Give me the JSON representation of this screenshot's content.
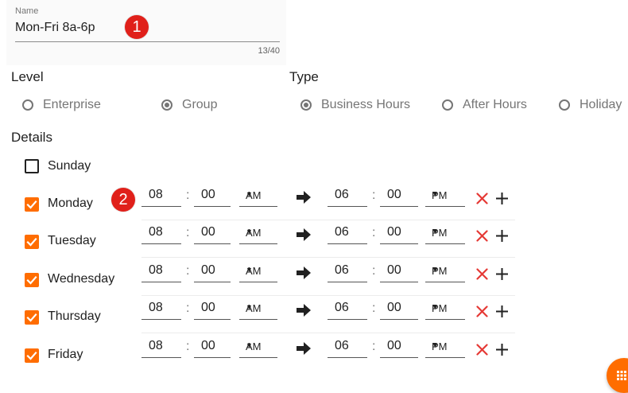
{
  "name_field": {
    "label": "Name",
    "value": "Mon-Fri 8a-6p",
    "counter": "13/40"
  },
  "markers": [
    "1",
    "2"
  ],
  "level": {
    "title": "Level",
    "options": [
      {
        "label": "Enterprise",
        "checked": false
      },
      {
        "label": "Group",
        "checked": true
      }
    ]
  },
  "type": {
    "title": "Type",
    "options": [
      {
        "label": "Business Hours",
        "checked": true
      },
      {
        "label": "After Hours",
        "checked": false
      },
      {
        "label": "Holiday",
        "checked": false
      }
    ]
  },
  "details": {
    "title": "Details",
    "days": [
      {
        "label": "Sunday",
        "checked": false
      },
      {
        "label": "Monday",
        "checked": true,
        "start_hour": "08",
        "start_min": "00",
        "start_ampm": "AM",
        "end_hour": "06",
        "end_min": "00",
        "end_ampm": "PM"
      },
      {
        "label": "Tuesday",
        "checked": true,
        "start_hour": "08",
        "start_min": "00",
        "start_ampm": "AM",
        "end_hour": "06",
        "end_min": "00",
        "end_ampm": "PM"
      },
      {
        "label": "Wednesday",
        "checked": true,
        "start_hour": "08",
        "start_min": "00",
        "start_ampm": "AM",
        "end_hour": "06",
        "end_min": "00",
        "end_ampm": "PM"
      },
      {
        "label": "Thursday",
        "checked": true,
        "start_hour": "08",
        "start_min": "00",
        "start_ampm": "AM",
        "end_hour": "06",
        "end_min": "00",
        "end_ampm": "PM"
      },
      {
        "label": "Friday",
        "checked": true,
        "start_hour": "08",
        "start_min": "00",
        "start_ampm": "AM",
        "end_hour": "06",
        "end_min": "00",
        "end_ampm": "PM"
      }
    ]
  },
  "time_separator": ":",
  "caret": "▼",
  "icons": {
    "arrow": "arrow-right-icon",
    "delete": "close-icon",
    "add": "plus-icon",
    "fab": "grid-icon"
  },
  "colors": {
    "accent": "#ff6d00",
    "delete": "#e53935",
    "marker": "#e0201a"
  }
}
